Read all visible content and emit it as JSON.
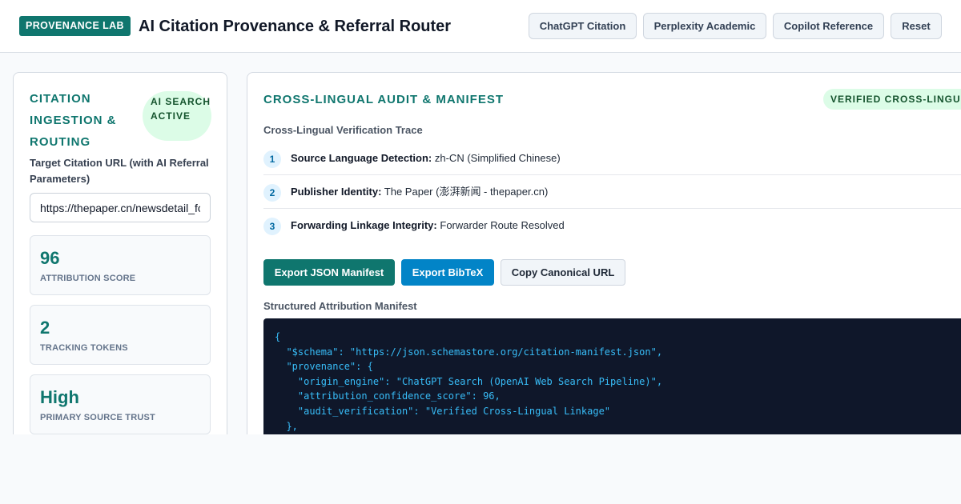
{
  "header": {
    "badge": "PROVENANCE LAB",
    "title": "AI Citation Provenance & Referral Router",
    "buttons": [
      "ChatGPT Citation",
      "Perplexity Academic",
      "Copilot Reference",
      "Reset"
    ]
  },
  "left_panel": {
    "title": "CITATION INGESTION & ROUTING",
    "status_pill": "AI SEARCH ACTIVE",
    "url_label": "Target Citation URL (with AI Referral Parameters)",
    "url_value": "https://thepaper.cn/newsdetail_forward",
    "metrics": [
      {
        "value": "96",
        "label": "ATTRIBUTION SCORE"
      },
      {
        "value": "2",
        "label": "TRACKING TOKENS"
      },
      {
        "value": "High",
        "label": "PRIMARY SOURCE TRUST"
      }
    ]
  },
  "right_panel": {
    "title": "CROSS-LINGUAL AUDIT & MANIFEST",
    "status_pill": "VERIFIED CROSS-LINGUAL",
    "trace_heading": "Cross-Lingual Verification Trace",
    "trace": [
      {
        "num": "1",
        "label": "Source Language Detection:",
        "value": "zh-CN (Simplified Chinese)"
      },
      {
        "num": "2",
        "label": "Publisher Identity:",
        "value": "The Paper (澎湃新闻 - thepaper.cn)"
      },
      {
        "num": "3",
        "label": "Forwarding Linkage Integrity:",
        "value": "Forwarder Route Resolved"
      }
    ],
    "actions": [
      "Export JSON Manifest",
      "Export BibTeX",
      "Copy Canonical URL"
    ],
    "manifest_heading": "Structured Attribution Manifest",
    "manifest_lines": [
      "{",
      "  \"$schema\": \"https://json.schemastore.org/citation-manifest.json\",",
      "  \"provenance\": {",
      "    \"origin_engine\": \"ChatGPT Search (OpenAI Web Search Pipeline)\",",
      "    \"attribution_confidence_score\": 96,",
      "    \"audit_verification\": \"Verified Cross-Lingual Linkage\"",
      "  },"
    ]
  },
  "colors": {
    "accent": "#0f766e",
    "secondary": "#0284c7",
    "pill_bg": "#dcfce7",
    "code_bg": "#0f172a",
    "code_text": "#38bdf8"
  }
}
